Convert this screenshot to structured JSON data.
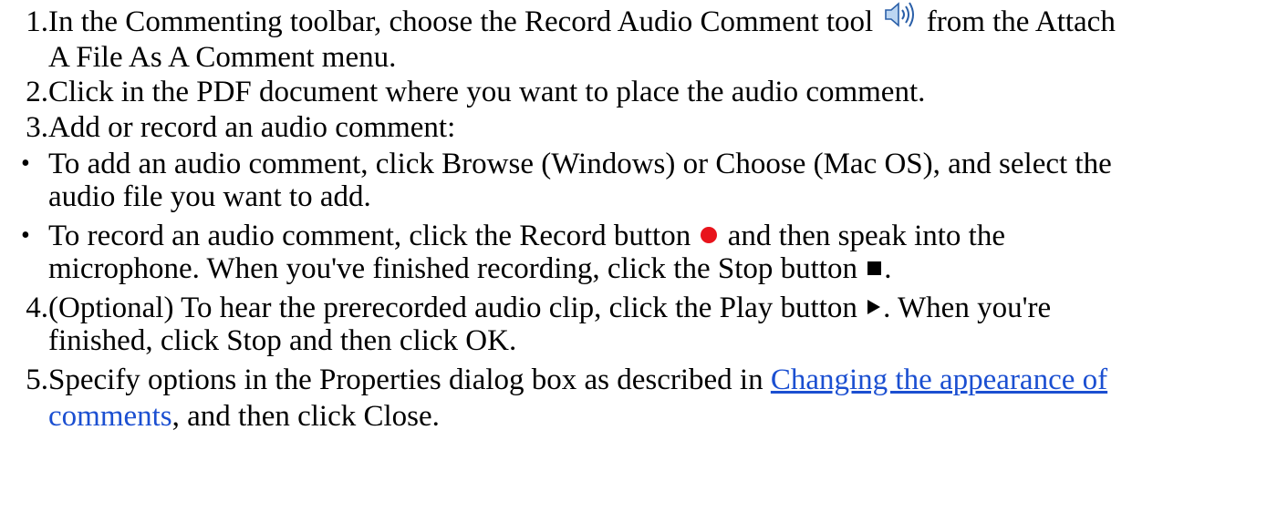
{
  "steps": [
    {
      "marker": "1.",
      "line1_before_icon": "In the Commenting toolbar, choose the Record Audio Comment tool",
      "icon": "speaker-icon",
      "line1_after_icon": "from the Attach",
      "line2": "A File As A Comment menu."
    },
    {
      "marker": "2.",
      "line1": "Click in the PDF document where you want to place the audio comment."
    },
    {
      "marker": "3.",
      "line1": "Add or record an audio comment:"
    },
    {
      "marker": "•",
      "line1": "To add an audio comment, click Browse (Windows) or Choose (Mac OS), and select the",
      "line2": "audio file you want to add."
    },
    {
      "marker": "•",
      "line1_before_icon": "To record an audio comment, click the Record button",
      "icon": "record-icon",
      "line1_after_icon": "and then speak into the",
      "line2_before_icon": "microphone. When you've finished recording, click the Stop button",
      "icon2": "stop-icon",
      "line2_after_icon": "."
    },
    {
      "marker": "4.",
      "line1_before_icon": "(Optional) To hear the prerecorded audio clip, click the Play button",
      "icon": "play-icon",
      "line1_after_icon": ". When you're",
      "line2": "finished, click Stop and then click OK."
    },
    {
      "marker": "5.",
      "line1_before_link": "Specify options in the Properties dialog box as described in",
      "link_text_line1": "Changing the appearance of",
      "link_text_line2": "comments",
      "line2_after_link": ", and then click Close."
    }
  ],
  "colors": {
    "text": "#000000",
    "link": "#1b4fd1",
    "record": "#e8141c",
    "background": "#ffffff"
  }
}
